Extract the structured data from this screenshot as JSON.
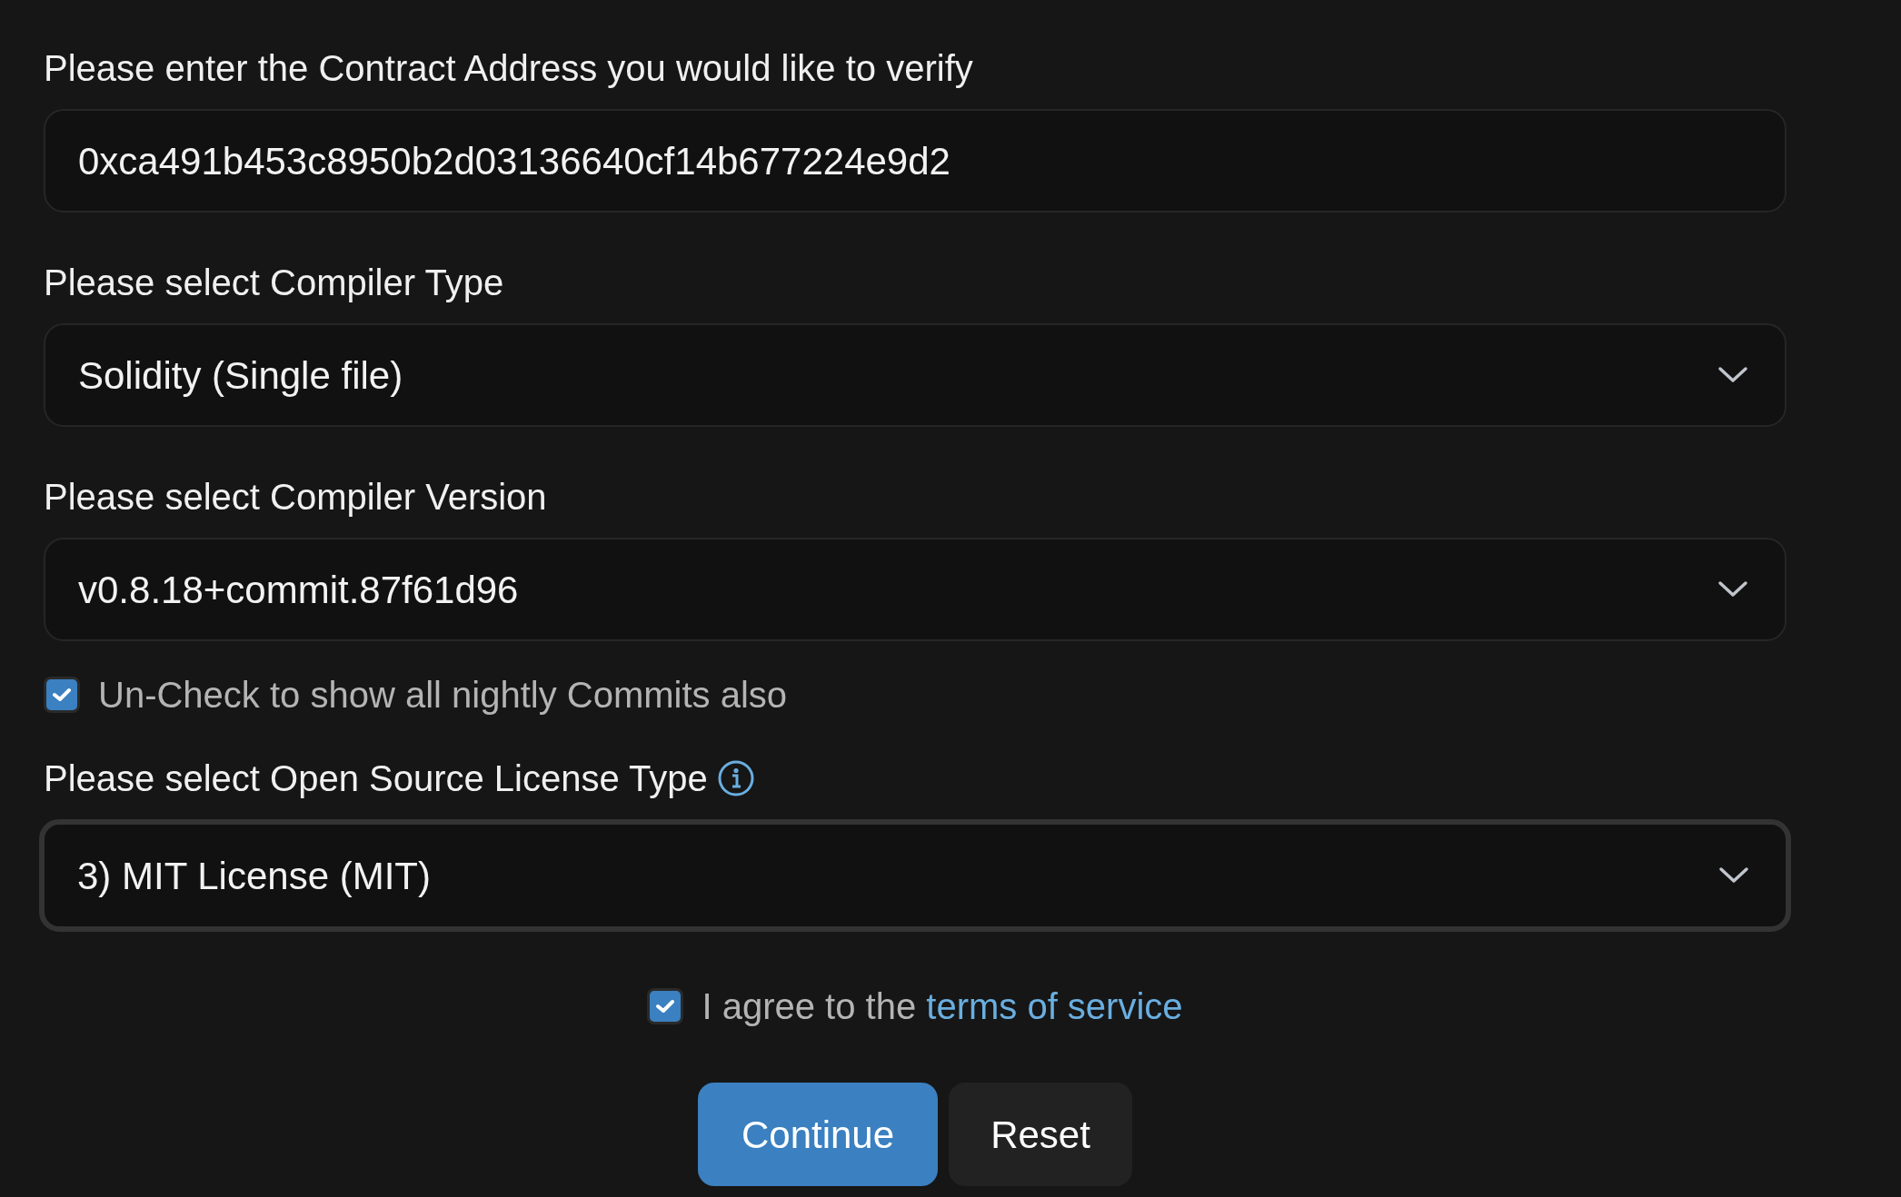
{
  "fields": [
    {
      "kind": "input",
      "label": "Please enter the Contract Address you would like to verify",
      "value": "0xca491b453c8950b2d03136640cf14b677224e9d2",
      "focused": false
    },
    {
      "kind": "select",
      "label": "Please select Compiler Type",
      "value": "Solidity (Single file)",
      "focused": false
    },
    {
      "kind": "select",
      "label": "Please select Compiler Version",
      "value": "v0.8.18+commit.87f61d96",
      "focused": false
    },
    {
      "kind": "checkbox",
      "label": "Un-Check to show all nightly Commits also",
      "checked": true
    },
    {
      "kind": "select",
      "label": "Please select Open Source License Type",
      "info": true,
      "value": "3) MIT License (MIT)",
      "focused": true
    }
  ],
  "agree": {
    "checked": true,
    "text": "I agree to the",
    "link": "terms of service"
  },
  "buttons": [
    {
      "label": "Continue",
      "primary": true
    },
    {
      "label": "Reset",
      "primary": false
    }
  ]
}
